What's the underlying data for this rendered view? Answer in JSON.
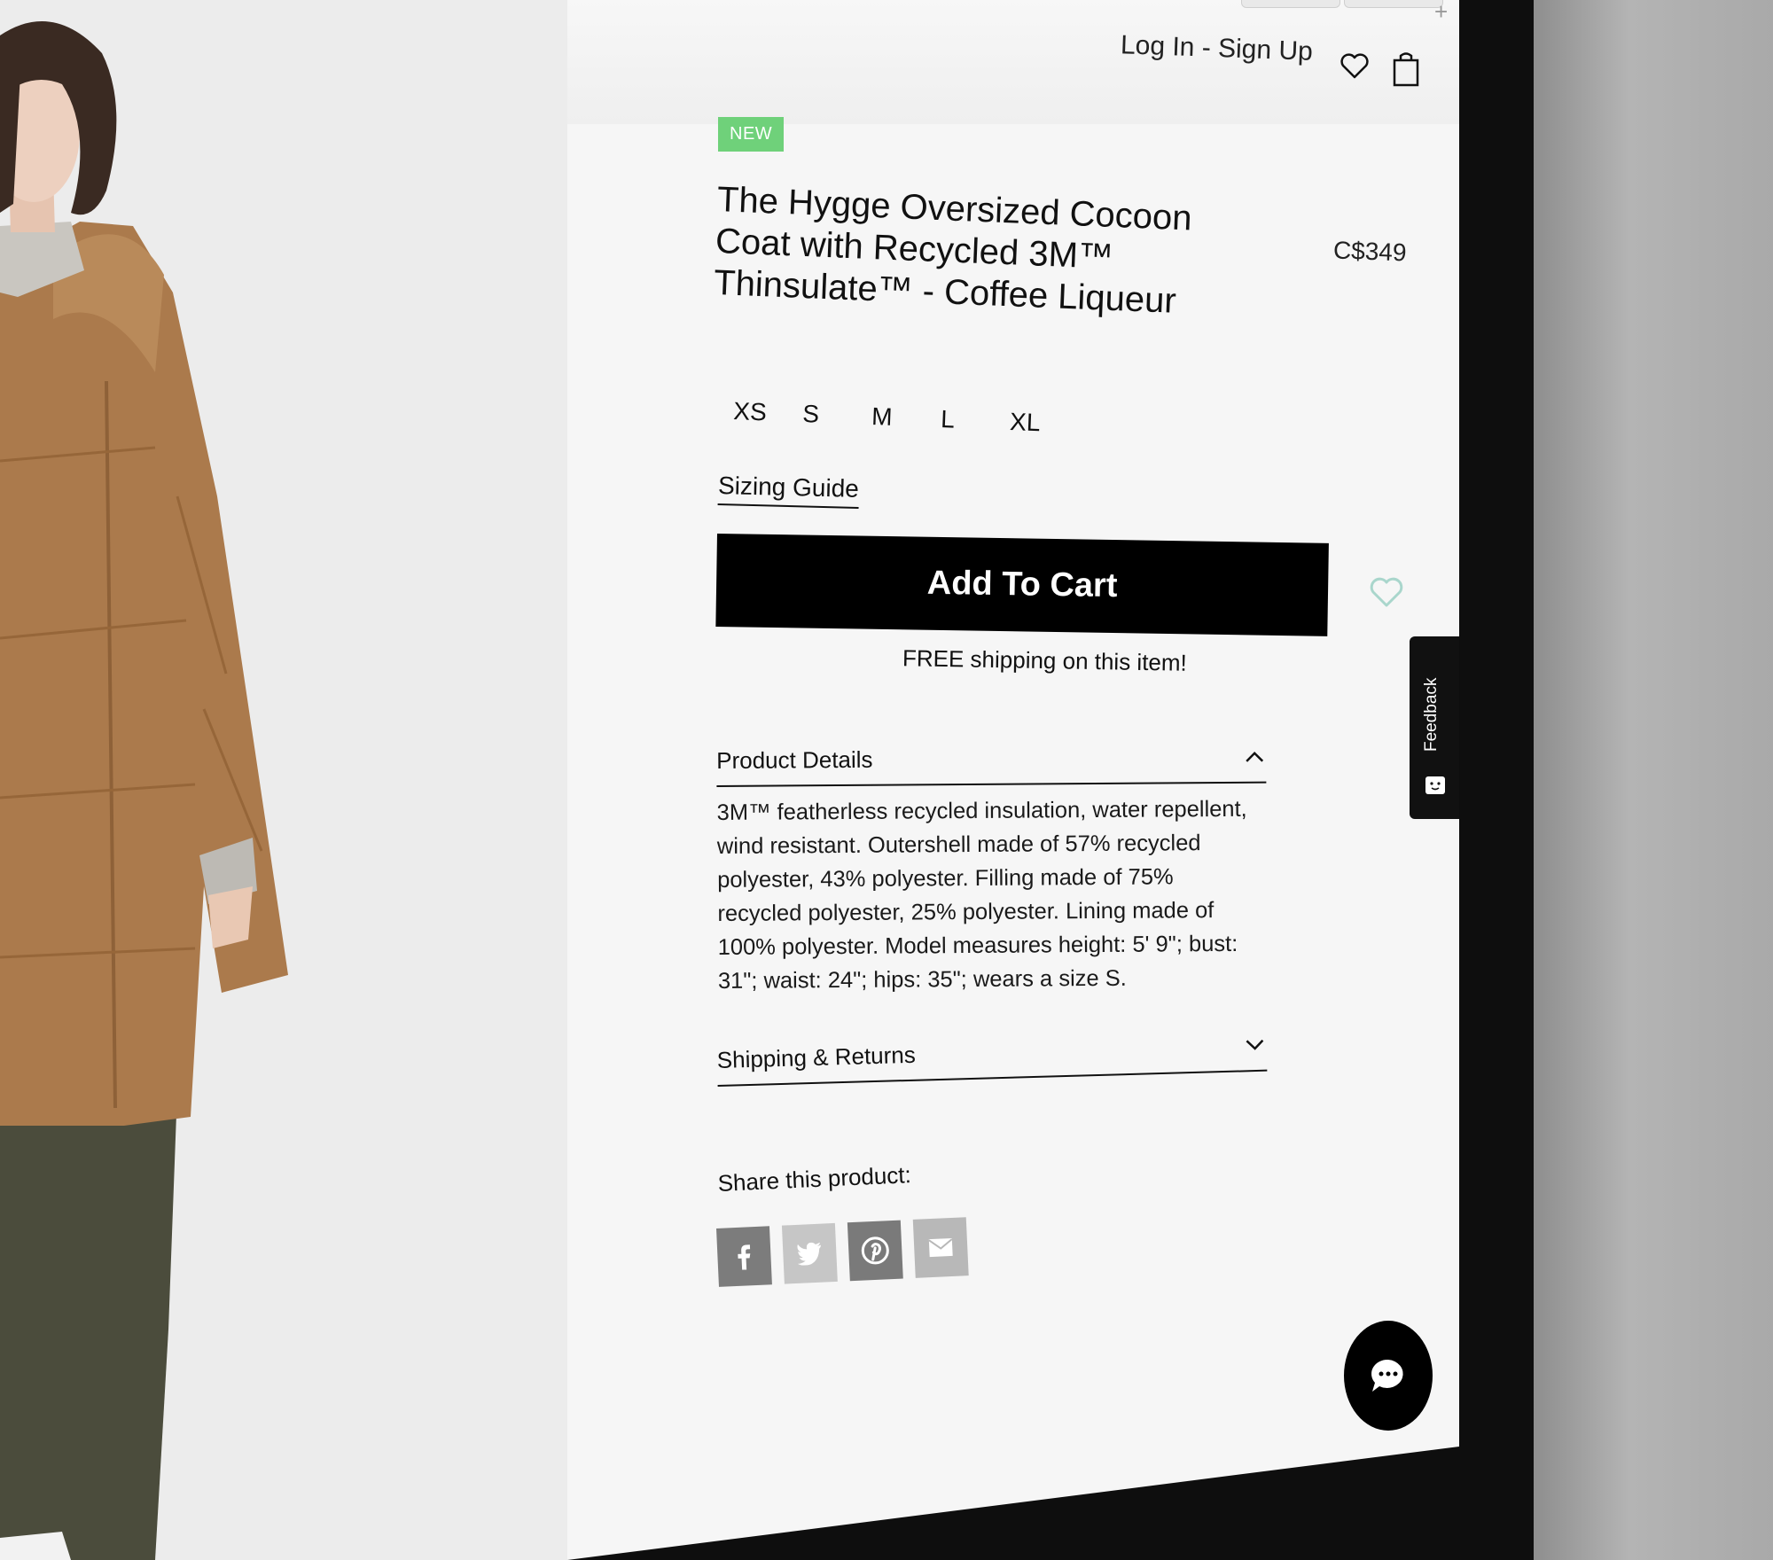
{
  "header": {
    "login_label": "Log In",
    "separator": " - ",
    "signup_label": "Sign Up"
  },
  "product": {
    "badge": "NEW",
    "title": "The Hygge Oversized Cocoon Coat with Recycled 3M™ Thinsulate™ - Coffee Liqueur",
    "price": "C$349",
    "sizes": [
      "XS",
      "S",
      "M",
      "L",
      "XL"
    ],
    "sizing_guide": "Sizing Guide",
    "add_to_cart": "Add To Cart",
    "free_shipping": "FREE shipping on this item!"
  },
  "accordion": {
    "details_title": "Product Details",
    "details_body": "3M™ featherless recycled insulation, water repellent, wind resistant. Outershell made of 57% recycled polyester, 43% polyester. Filling made of 75% recycled polyester, 25% polyester. Lining made of 100% polyester. Model measures height: 5' 9\"; bust: 31\"; waist: 24\"; hips: 35\"; wears a size S.",
    "shipping_title": "Shipping & Returns"
  },
  "share": {
    "label": "Share this product:",
    "icons": [
      "facebook-icon",
      "twitter-icon",
      "pinterest-icon",
      "email-icon"
    ]
  },
  "feedback": {
    "label": "Feedback"
  },
  "colors": {
    "badge_green": "#6fd17a",
    "wishlist_mint": "#a9d6cc",
    "button_black": "#000000",
    "coat_brown": "#ab7a4c"
  }
}
